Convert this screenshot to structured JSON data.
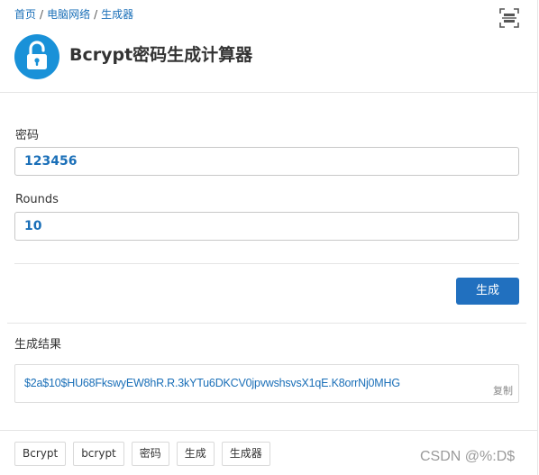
{
  "breadcrumb": {
    "home": "首页",
    "category": "电脑网络",
    "current": "生成器",
    "separator": "/"
  },
  "header": {
    "title": "Bcrypt密码生成计算器",
    "icon": "lock-icon",
    "scan_icon": "scan-icon",
    "accent_color": "#1991d8"
  },
  "form": {
    "password_label": "密码",
    "password_value": "123456",
    "rounds_label": "Rounds",
    "rounds_value": "10",
    "generate_label": "生成",
    "button_color": "#2170bf"
  },
  "result": {
    "label": "生成结果",
    "value": "$2a$10$HU68FkswyEW8hR.R.3kYTu6DKCV0jpvwshsvsX1qE.K8orrNj0MHG",
    "copy_label": "复制"
  },
  "tags": [
    "Bcrypt",
    "bcrypt",
    "密码",
    "生成",
    "生成器"
  ],
  "watermark": "CSDN @%:D$"
}
